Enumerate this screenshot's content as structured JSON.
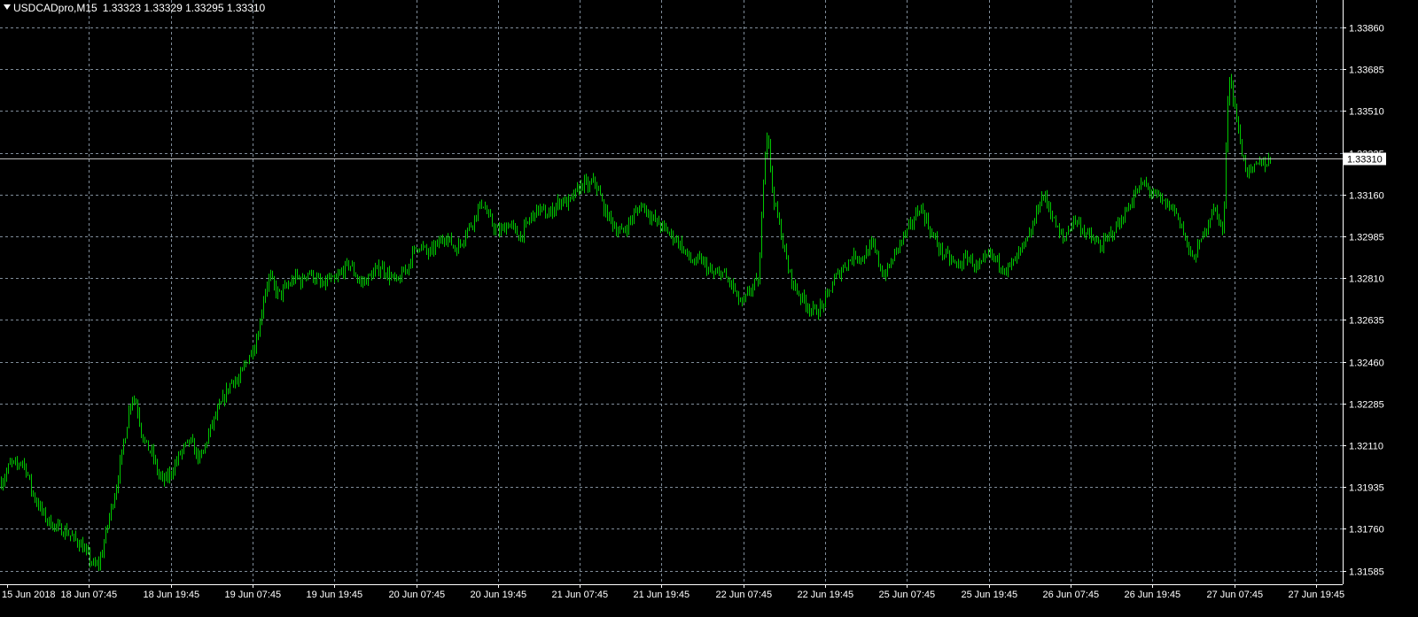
{
  "header": {
    "symbol": "USDCADpro,M15",
    "quote": "1.33323 1.33329 1.33295 1.33310"
  },
  "colors": {
    "background": "#000000",
    "candle": "#00c800",
    "grid": "#7f8c99",
    "text": "#ffffff",
    "price_line": "#c0c0c0",
    "price_label_bg": "#ffffff",
    "price_label_text": "#000000"
  },
  "chart_data": {
    "type": "line",
    "chart_style": "bar-ohlc",
    "timeframe": "M15",
    "grid": true,
    "current_price": "1.33310",
    "price_ticks": [
      "1.33860",
      "1.33685",
      "1.33510",
      "1.33335",
      "1.33160",
      "1.32985",
      "1.32810",
      "1.32635",
      "1.32460",
      "1.32285",
      "1.32110",
      "1.31935",
      "1.31760",
      "1.31585"
    ],
    "ylim": [
      1.3156,
      1.339
    ],
    "time_labels": [
      "15 Jun 2018",
      "18 Jun 07:45",
      "18 Jun 19:45",
      "19 Jun 07:45",
      "19 Jun 19:45",
      "20 Jun 07:45",
      "20 Jun 19:45",
      "21 Jun 07:45",
      "21 Jun 19:45",
      "22 Jun 07:45",
      "22 Jun 19:45",
      "25 Jun 07:45",
      "25 Jun 19:45",
      "26 Jun 07:45",
      "26 Jun 19:45",
      "27 Jun 07:45",
      "27 Jun 19:45"
    ],
    "series": [
      {
        "x": [
          0,
          5,
          12,
          18,
          24,
          30,
          36,
          43,
          50,
          58,
          66,
          74,
          82,
          90,
          98,
          106,
          112,
          118,
          124,
          130,
          136,
          142,
          148,
          154,
          160,
          166,
          172,
          178,
          184,
          190,
          196,
          202,
          208,
          214,
          220,
          226,
          232,
          238,
          244,
          250,
          256,
          262,
          268,
          274,
          280,
          286,
          292,
          298,
          304,
          310,
          316,
          322,
          328,
          334,
          340,
          346,
          352,
          358,
          364,
          370,
          376,
          382,
          388,
          394,
          400,
          406,
          412,
          418,
          424,
          430,
          436,
          442,
          448,
          454,
          460,
          466,
          472,
          478,
          484,
          490,
          496,
          502,
          508,
          514,
          520,
          526,
          532,
          538,
          544,
          550,
          556,
          562,
          568,
          574,
          580,
          586,
          592,
          598,
          604,
          610,
          616,
          622,
          628,
          634,
          640,
          646,
          652,
          658,
          664,
          670,
          676,
          682,
          688,
          694,
          700,
          706,
          712,
          718,
          724,
          730,
          736,
          742,
          748,
          754,
          760,
          766,
          772,
          778,
          784,
          790,
          796,
          802,
          808,
          814,
          820,
          826,
          832,
          838,
          844,
          850,
          856,
          862,
          866,
          870,
          876,
          882,
          888,
          894,
          900,
          906,
          912,
          918,
          924,
          930,
          936,
          942,
          948,
          954,
          960,
          966,
          972,
          978,
          984,
          990,
          996,
          1002,
          1008,
          1014,
          1020,
          1026,
          1032,
          1038,
          1044,
          1050,
          1056,
          1062,
          1068,
          1074,
          1080,
          1086,
          1092,
          1098,
          1104,
          1110,
          1116,
          1122,
          1128,
          1134,
          1140,
          1146,
          1152,
          1158,
          1164,
          1170,
          1176,
          1182,
          1188,
          1194,
          1200,
          1206,
          1212,
          1218,
          1224,
          1230,
          1236,
          1242,
          1248,
          1254,
          1260,
          1266,
          1272,
          1278,
          1284,
          1290,
          1296,
          1302,
          1308,
          1314,
          1320,
          1326,
          1332,
          1338,
          1344,
          1350,
          1356,
          1362,
          1368,
          1374,
          1380,
          1386,
          1392,
          1398,
          1404,
          1410,
          1416,
          1422,
          1428,
          1434,
          1440,
          1446,
          1452,
          1458,
          1464,
          1468,
          1472,
          1476,
          1480,
          1484,
          1488,
          1494,
          1500,
          1506,
          1510
        ],
        "close": [
          1.3195,
          1.3198,
          1.3204,
          1.3202,
          1.3205,
          1.32,
          1.3191,
          1.3186,
          1.3181,
          1.3178,
          1.3176,
          1.3175,
          1.3172,
          1.317,
          1.3165,
          1.316,
          1.3162,
          1.3172,
          1.3183,
          1.3192,
          1.3205,
          1.3218,
          1.3232,
          1.3228,
          1.3215,
          1.321,
          1.3207,
          1.3199,
          1.3196,
          1.3198,
          1.3202,
          1.3207,
          1.321,
          1.3213,
          1.3208,
          1.3205,
          1.3212,
          1.3219,
          1.3224,
          1.3229,
          1.3234,
          1.3239,
          1.3237,
          1.3243,
          1.3248,
          1.3252,
          1.326,
          1.3275,
          1.3282,
          1.3276,
          1.3274,
          1.3277,
          1.3279,
          1.3282,
          1.3279,
          1.3284,
          1.3282,
          1.328,
          1.3277,
          1.3281,
          1.3279,
          1.3282,
          1.3285,
          1.3287,
          1.3283,
          1.3279,
          1.328,
          1.3282,
          1.3284,
          1.3286,
          1.3283,
          1.3281,
          1.3279,
          1.3283,
          1.3286,
          1.3292,
          1.3295,
          1.3293,
          1.3291,
          1.3294,
          1.3296,
          1.3299,
          1.3296,
          1.3293,
          1.3296,
          1.3301,
          1.3304,
          1.3309,
          1.3313,
          1.3307,
          1.3303,
          1.33,
          1.3302,
          1.3304,
          1.3301,
          1.3298,
          1.3302,
          1.3306,
          1.3309,
          1.331,
          1.3307,
          1.3309,
          1.3312,
          1.3314,
          1.3312,
          1.3315,
          1.3318,
          1.3321,
          1.3319,
          1.3322,
          1.3316,
          1.3309,
          1.3306,
          1.3302,
          1.33,
          1.3302,
          1.3306,
          1.3309,
          1.3312,
          1.3309,
          1.3306,
          1.3304,
          1.3302,
          1.33,
          1.3298,
          1.3296,
          1.3292,
          1.3289,
          1.3287,
          1.3289,
          1.3286,
          1.3283,
          1.3282,
          1.3284,
          1.328,
          1.3278,
          1.3272,
          1.327,
          1.3275,
          1.3278,
          1.328,
          1.3332,
          1.3345,
          1.332,
          1.3308,
          1.3298,
          1.3286,
          1.3279,
          1.3275,
          1.3272,
          1.3269,
          1.3267,
          1.3268,
          1.3271,
          1.3276,
          1.3281,
          1.3284,
          1.3287,
          1.3289,
          1.3291,
          1.3289,
          1.3292,
          1.3295,
          1.3289,
          1.3282,
          1.3285,
          1.329,
          1.3295,
          1.3299,
          1.3302,
          1.3307,
          1.3311,
          1.3306,
          1.33,
          1.3296,
          1.3292,
          1.329,
          1.3288,
          1.3286,
          1.3288,
          1.329,
          1.3287,
          1.3285,
          1.3288,
          1.3291,
          1.3289,
          1.3287,
          1.3285,
          1.3286,
          1.3289,
          1.3293,
          1.3296,
          1.3301,
          1.331,
          1.3316,
          1.3312,
          1.3306,
          1.33,
          1.3297,
          1.3302,
          1.3306,
          1.3303,
          1.33,
          1.3298,
          1.3296,
          1.3294,
          1.3297,
          1.33,
          1.3303,
          1.3306,
          1.331,
          1.3315,
          1.3318,
          1.3321,
          1.3318,
          1.3316,
          1.3314,
          1.3312,
          1.3311,
          1.3309,
          1.3304,
          1.3296,
          1.3289,
          1.3292,
          1.3298,
          1.3304,
          1.331,
          1.3307,
          1.33,
          1.3368,
          1.3355,
          1.334,
          1.3328,
          1.3325,
          1.3327,
          1.333,
          1.3329,
          1.3331
        ]
      }
    ]
  }
}
